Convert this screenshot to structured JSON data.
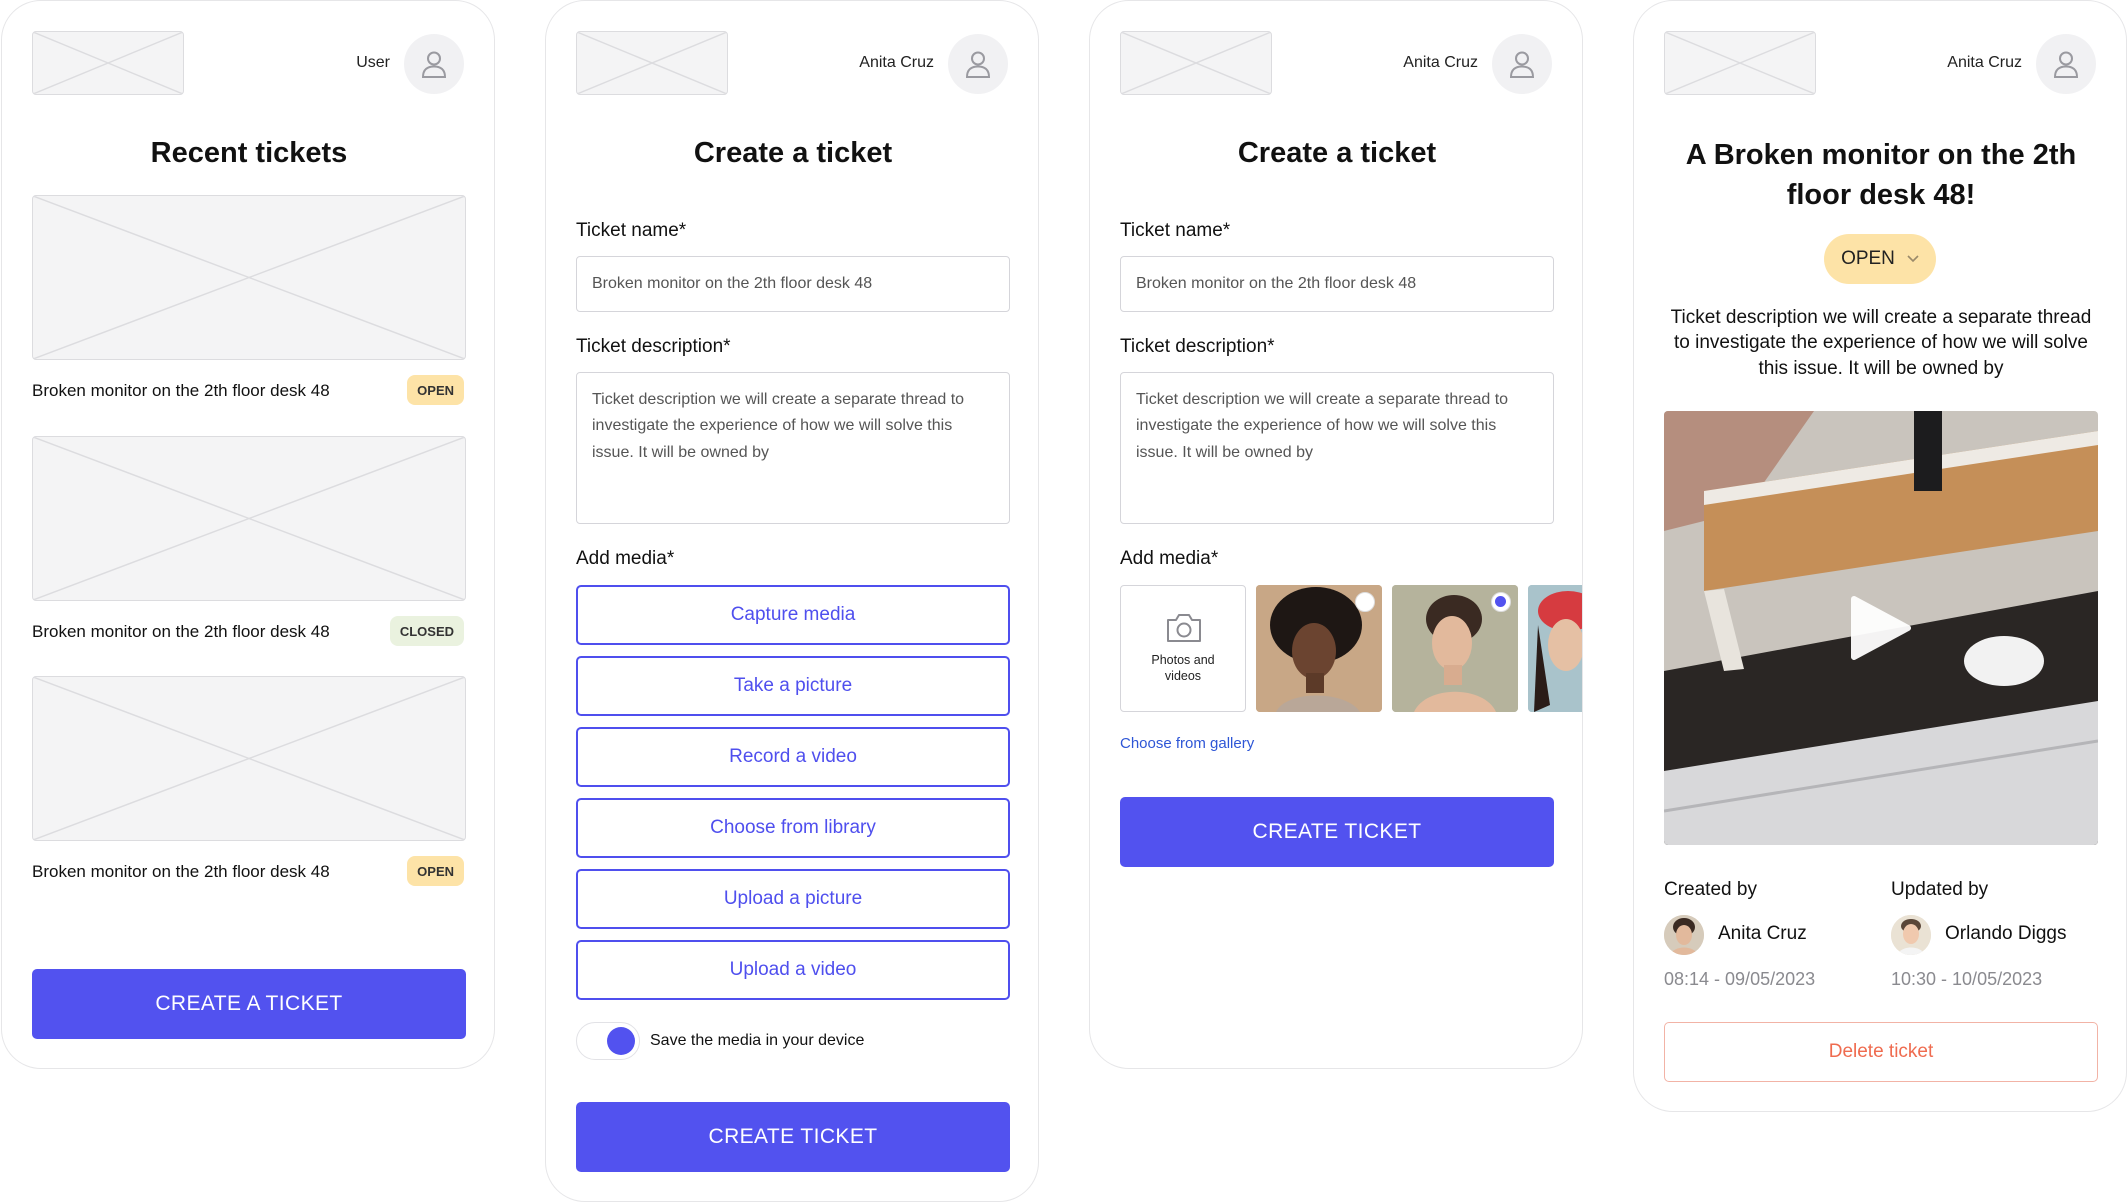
{
  "screen1": {
    "user_name": "User",
    "title": "Recent tickets",
    "tickets": [
      {
        "title": "Broken monitor on the 2th floor desk 48",
        "status": "OPEN"
      },
      {
        "title": "Broken monitor on the 2th floor desk 48",
        "status": "CLOSED"
      },
      {
        "title": "Broken monitor on the 2th floor desk 48",
        "status": "OPEN"
      }
    ],
    "create_button": "CREATE A TICKET"
  },
  "screen2": {
    "user_name": "Anita Cruz",
    "title": "Create a ticket",
    "ticket_name_label": "Ticket name*",
    "ticket_name_value": "Broken monitor on the 2th floor desk 48",
    "description_label": "Ticket description*",
    "description_value": "Ticket description we will create a separate thread to investigate the experience of how we will solve this issue. It will be owned by",
    "media_label": "Add media*",
    "media_options": [
      "Capture media",
      "Take a picture",
      "Record a video",
      "Choose from library",
      "Upload a picture",
      "Upload a video"
    ],
    "save_toggle_label": "Save the media in your device",
    "save_toggle_on": true,
    "submit_button": "CREATE TICKET"
  },
  "screen3": {
    "user_name": "Anita Cruz",
    "title": "Create a ticket",
    "ticket_name_label": "Ticket name*",
    "ticket_name_value": "Broken monitor on the 2th floor desk 48",
    "description_label": "Ticket description*",
    "description_value": "Ticket description we will create a separate thread to investigate the experience of how we will solve this issue. It will be owned by",
    "media_label": "Add media*",
    "photos_tile_label": "Photos and videos",
    "gallery_link": "Choose from gallery",
    "submit_button": "CREATE TICKET"
  },
  "screen4": {
    "user_name": "Anita Cruz",
    "title": "A Broken monitor on the 2th floor desk 48!",
    "status": "OPEN",
    "description": "Ticket description we will create a separate thread to investigate the experience of how we will solve this issue. It will be owned by",
    "created_by_label": "Created by",
    "created_by_name": "Anita Cruz",
    "created_at": "08:14 - 09/05/2023",
    "updated_by_label": "Updated by",
    "updated_by_name": "Orlando Diggs",
    "updated_at": "10:30 - 10/05/2023",
    "delete_button": "Delete ticket"
  },
  "colors": {
    "primary": "#5252ef",
    "badge_open": "#fde3a7",
    "badge_closed": "#eaf2df",
    "danger": "#ef6b4f"
  },
  "icons": [
    "user-icon",
    "camera-icon",
    "play-icon",
    "chevron-down-icon"
  ]
}
